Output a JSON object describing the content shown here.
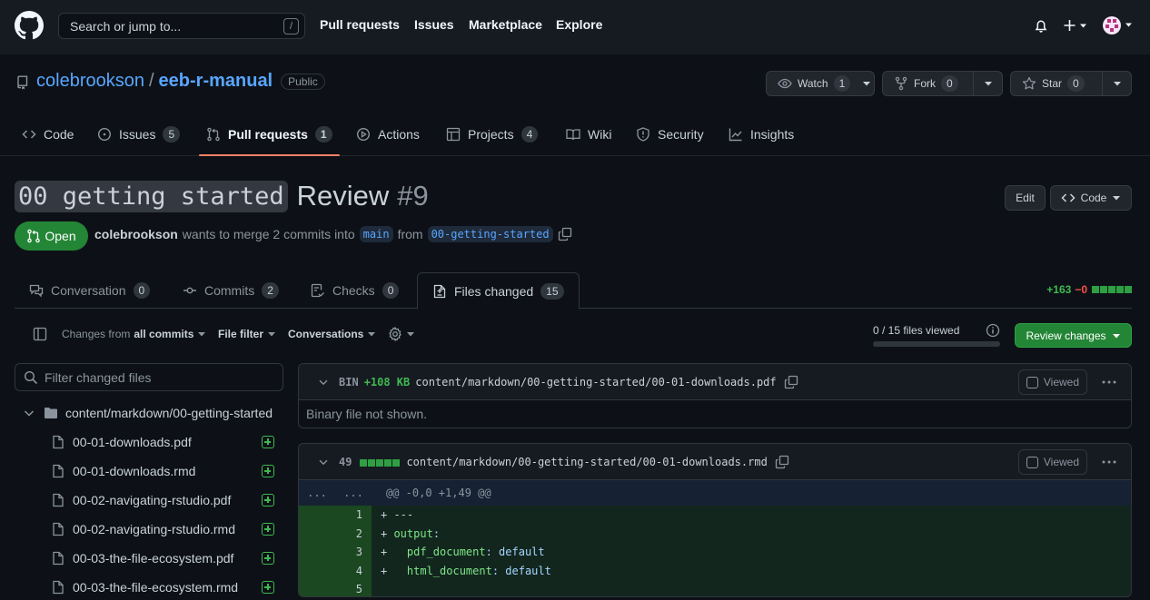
{
  "header": {
    "search_placeholder": "Search or jump to...",
    "search_shortcut": "/",
    "nav": [
      "Pull requests",
      "Issues",
      "Marketplace",
      "Explore"
    ]
  },
  "repo": {
    "owner": "colebrookson",
    "separator": "/",
    "name": "eeb-r-manual",
    "visibility": "Public",
    "watch": {
      "label": "Watch",
      "count": "1"
    },
    "fork": {
      "label": "Fork",
      "count": "0"
    },
    "star": {
      "label": "Star",
      "count": "0"
    }
  },
  "repo_tabs": [
    {
      "label": "Code",
      "count": ""
    },
    {
      "label": "Issues",
      "count": "5"
    },
    {
      "label": "Pull requests",
      "count": "1"
    },
    {
      "label": "Actions",
      "count": ""
    },
    {
      "label": "Projects",
      "count": "4"
    },
    {
      "label": "Wiki",
      "count": ""
    },
    {
      "label": "Security",
      "count": ""
    },
    {
      "label": "Insights",
      "count": ""
    }
  ],
  "pr": {
    "title_code": "00 getting started",
    "title_rest": "Review",
    "number": "#9",
    "edit_label": "Edit",
    "code_label": "Code",
    "state": "Open",
    "author": "colebrookson",
    "merge_text": "wants to merge 2 commits into",
    "base_branch": "main",
    "from_text": "from",
    "head_branch": "00-getting-started"
  },
  "pr_tabs": [
    {
      "label": "Conversation",
      "count": "0"
    },
    {
      "label": "Commits",
      "count": "2"
    },
    {
      "label": "Checks",
      "count": "0"
    },
    {
      "label": "Files changed",
      "count": "15"
    }
  ],
  "diffstat": {
    "additions": "+163",
    "deletions": "−0"
  },
  "toolbar": {
    "changes_from_prefix": "Changes from",
    "changes_from_value": "all commits",
    "file_filter": "File filter",
    "conversations": "Conversations",
    "files_viewed": "0 / 15 files viewed",
    "files_viewed_fraction": 0,
    "review_changes": "Review changes"
  },
  "file_tree": {
    "filter_placeholder": "Filter changed files",
    "folder": "content/markdown/00-getting-started",
    "files": [
      "00-01-downloads.pdf",
      "00-01-downloads.rmd",
      "00-02-navigating-rstudio.pdf",
      "00-02-navigating-rstudio.rmd",
      "00-03-the-file-ecosystem.pdf",
      "00-03-the-file-ecosystem.rmd"
    ]
  },
  "files": [
    {
      "badge": "BIN",
      "size": "+108 KB",
      "path": "content/markdown/00-getting-started/00-01-downloads.pdf",
      "viewed_label": "Viewed",
      "body": "Binary file not shown."
    },
    {
      "changes": "49",
      "path": "content/markdown/00-getting-started/00-01-downloads.rmd",
      "viewed_label": "Viewed",
      "hunk_left": "...",
      "hunk_right": "...",
      "hunk_header": "@@ -0,0 +1,49 @@",
      "lines": [
        {
          "num": "1",
          "prefix": "+",
          "text": " ---"
        },
        {
          "num": "2",
          "prefix": "+",
          "key": " output",
          "val": ":"
        },
        {
          "num": "3",
          "prefix": "+",
          "key": "   pdf_document",
          "val": ": default"
        },
        {
          "num": "4",
          "prefix": "+",
          "key": "   html_document",
          "val": ": default"
        },
        {
          "num": "5",
          "prefix": "",
          "text": ""
        }
      ]
    }
  ],
  "colors": {
    "accent": "#58a6ff",
    "success": "#238636",
    "tab_underline": "#f78166",
    "added": "#3fb950",
    "deleted": "#f85149"
  }
}
